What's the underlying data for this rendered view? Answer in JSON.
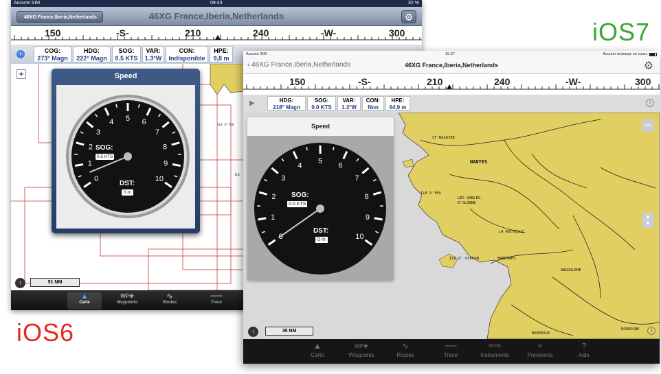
{
  "labels": {
    "ios7": "iOS7",
    "ios6": "iOS6"
  },
  "ios6": {
    "status": {
      "carrier": "Aucune SIM",
      "time": "09:43",
      "battery": "32 %"
    },
    "nav": {
      "back": "46XG France,Iberia,Netherlands",
      "title": "46XG France,Iberia,Netherlands"
    },
    "ruler": [
      "150",
      "-S-",
      "210",
      "240",
      "-W-",
      "300"
    ],
    "info": [
      {
        "k": "COG:",
        "v": "273° Magn"
      },
      {
        "k": "HDG:",
        "v": "222° Magn"
      },
      {
        "k": "SOG:",
        "v": "0.5 KTS"
      },
      {
        "k": "VAR:",
        "v": "1.3°W"
      },
      {
        "k": "CON:",
        "v": "Indisponible"
      },
      {
        "k": "HPE:",
        "v": "9,8 m"
      }
    ],
    "panel": {
      "title": "Speed",
      "sog_label": "SOG:",
      "sog_value": "0.5 KTS",
      "dst_label": "DST:",
      "dst_value": "0 m",
      "needle_value": 0.5
    },
    "gauge_numbers": [
      "0",
      "1",
      "2",
      "3",
      "4",
      "5",
      "6",
      "7",
      "8",
      "9",
      "10"
    ],
    "map": {
      "place": "ILE D'YEU",
      "place2": "ILE"
    },
    "scale": "51 NM",
    "tabs": [
      "Carte",
      "Waypoints",
      "Routes",
      "Trace"
    ]
  },
  "ios7": {
    "status": {
      "carrier": "Aucune SIM",
      "time": "15:37",
      "battery": "Aucune recharge en cours"
    },
    "nav": {
      "back": "46XG France,Iberia,Netherlands",
      "title": "46XG France,Iberia,Netherlands"
    },
    "ruler": [
      "150",
      "-S-",
      "210",
      "240",
      "-W-",
      "300"
    ],
    "info": [
      {
        "k": "HDG:",
        "v": "218° Magn"
      },
      {
        "k": "SOG:",
        "v": "0.0 KTS"
      },
      {
        "k": "VAR:",
        "v": "1.3°W"
      },
      {
        "k": "CON:",
        "v": "Non"
      },
      {
        "k": "HPE:",
        "v": "64,9 m"
      }
    ],
    "panel": {
      "title": "Speed",
      "sog_label": "SOG:",
      "sog_value": "0.0 KTS",
      "dst_label": "DST:",
      "dst_value": "0 m",
      "needle_value": 0.0
    },
    "gauge_numbers": [
      "0",
      "1",
      "2",
      "3",
      "4",
      "5",
      "6",
      "7",
      "8",
      "9",
      "10"
    ],
    "map": {
      "places": [
        "ST-NAZAIRE",
        "NANTES",
        "ILE D'YEU",
        "LES SABLES-",
        "D'OLONNE",
        "LA ROCHELLE",
        "ILE D' OLERON",
        "MARENNES",
        "ANGOULEME",
        "BORDEAUX",
        "DORDOGNE"
      ]
    },
    "scale": "35 NM",
    "tabs": [
      {
        "icon": "▲",
        "label": "Carte"
      },
      {
        "icon": "WP✚",
        "label": "Waypoints"
      },
      {
        "icon": "∿",
        "label": "Routes"
      },
      {
        "icon": "═══",
        "label": "Trace"
      },
      {
        "icon": "00.00",
        "label": "Instruments"
      },
      {
        "icon": "≈",
        "label": "Prévisions"
      },
      {
        "icon": "?",
        "label": "Aide"
      }
    ]
  },
  "colors": {
    "ios7_label": "#3aa534",
    "ios6_label": "#e8251f",
    "land": "#e2cf62",
    "sea": "#d9d9d9"
  }
}
